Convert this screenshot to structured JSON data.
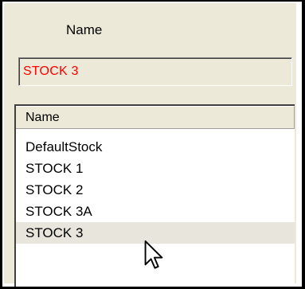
{
  "name_caption": "Name",
  "name_field": {
    "value": "STOCK 3",
    "text_color": "#ff0000"
  },
  "stock_list": {
    "column_header": "Name",
    "items": [
      {
        "label": "DefaultStock",
        "selected": false
      },
      {
        "label": "STOCK 1",
        "selected": false
      },
      {
        "label": "STOCK 2",
        "selected": false
      },
      {
        "label": "STOCK 3A",
        "selected": false
      },
      {
        "label": "STOCK 3",
        "selected": true
      }
    ]
  },
  "colors": {
    "panel_background": "#ece9d8",
    "list_background": "#ffffff",
    "selected_row": "#e8e6dc"
  },
  "cursor_icon": "arrow-cursor-icon"
}
